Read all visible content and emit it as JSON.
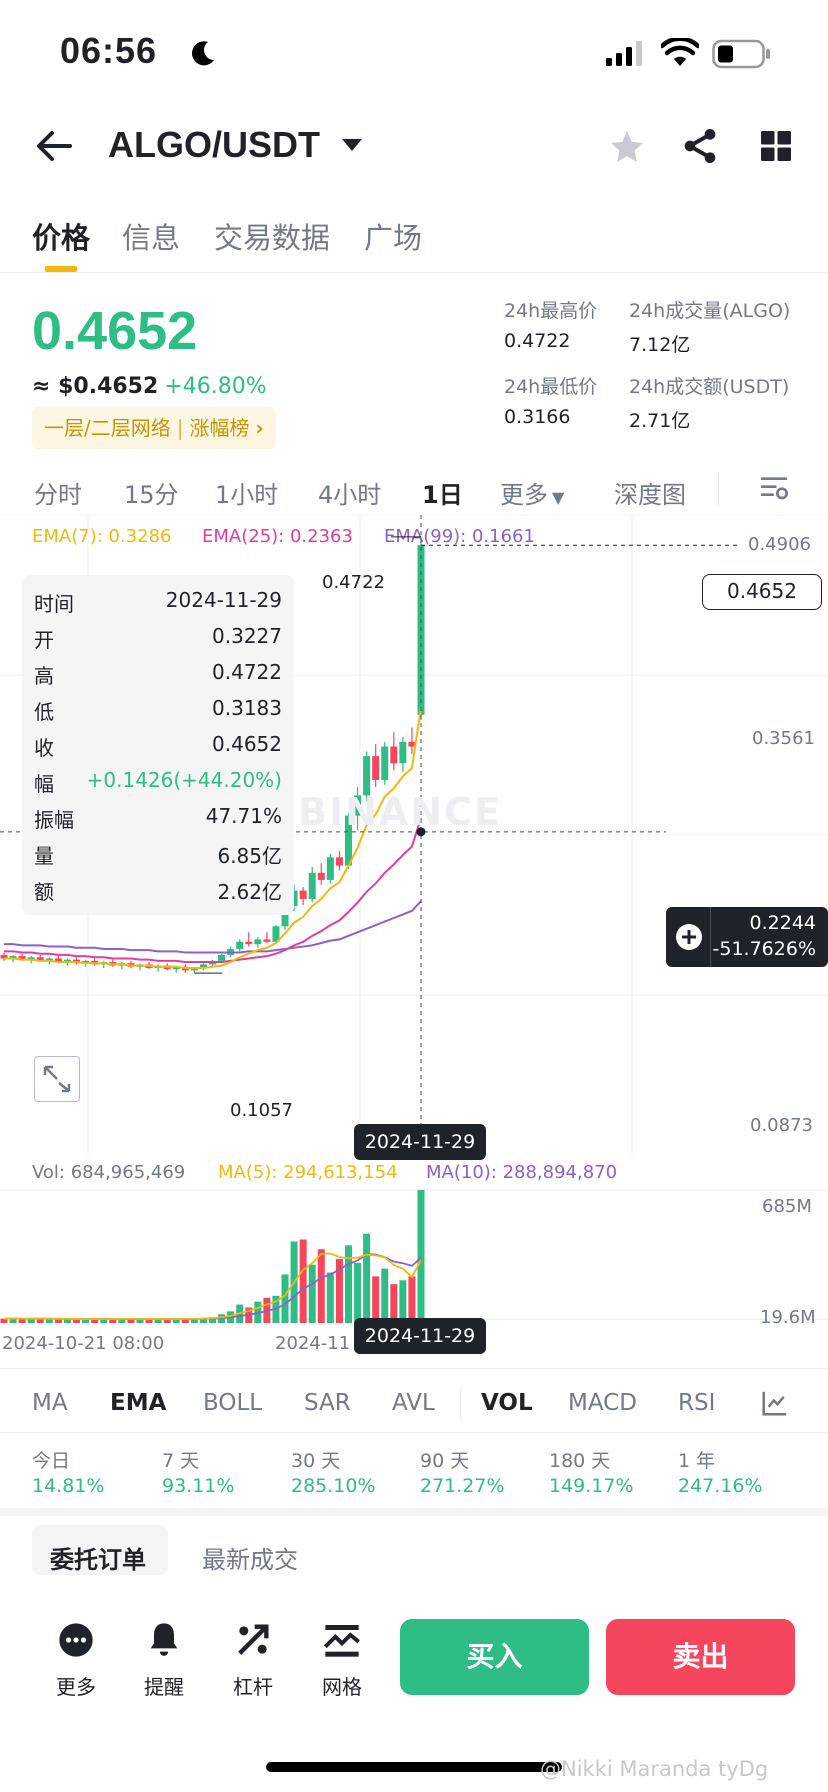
{
  "status": {
    "time": "06:56"
  },
  "header": {
    "pair": "ALGO/USDT"
  },
  "tabs": [
    "价格",
    "信息",
    "交易数据",
    "广场"
  ],
  "ticker": {
    "price": "0.4652",
    "usd": "≈ $0.4652",
    "change": "+46.80%",
    "tag": "一层/二层网络",
    "tag_link": "涨幅榜",
    "high_label": "24h最高价",
    "high": "0.4722",
    "low_label": "24h最低价",
    "low": "0.3166",
    "vol_label": "24h成交量(ALGO)",
    "vol": "7.12亿",
    "amt_label": "24h成交额(USDT)",
    "amt": "2.71亿"
  },
  "timeframes": [
    "分时",
    "15分",
    "1小时",
    "4小时",
    "1日",
    "更多",
    "深度图"
  ],
  "ema": {
    "e7": "EMA(7): 0.3286",
    "e25": "EMA(25): 0.2363",
    "e99": "EMA(99): 0.1661"
  },
  "price_axis": [
    "0.4906",
    "0.3561",
    "0.0873"
  ],
  "info": {
    "rows": [
      {
        "k": "时间",
        "v": "2024-11-29"
      },
      {
        "k": "开",
        "v": "0.3227"
      },
      {
        "k": "高",
        "v": "0.4722"
      },
      {
        "k": "低",
        "v": "0.3183"
      },
      {
        "k": "收",
        "v": "0.4652"
      },
      {
        "k": "幅",
        "v": "+0.1426(+44.20%)"
      },
      {
        "k": "振幅",
        "v": "47.71%"
      },
      {
        "k": "量",
        "v": "6.85亿"
      },
      {
        "k": "额",
        "v": "2.62亿"
      }
    ]
  },
  "chart_labels": {
    "high_mark": "0.4722",
    "low_mark": "0.1057",
    "last_price": "0.4652",
    "cross_price": "0.2244",
    "cross_pct": "-51.7626%",
    "cross_date": "2024-11-29",
    "watermark": "BINANCE"
  },
  "volume": {
    "vol": "Vol: 684,965,469",
    "ma5": "MA(5): 294,613,154",
    "ma10": "MA(10): 288,894,870",
    "axis_top": "685M",
    "axis_bottom": "19.6M",
    "x_start": "2024-10-21 08:00",
    "x_mid": "2024-11",
    "date_tip": "2024-11-29"
  },
  "indicators": [
    "MA",
    "EMA",
    "BOLL",
    "SAR",
    "AVL",
    "VOL",
    "MACD",
    "RSI"
  ],
  "performance": [
    {
      "label": "今日",
      "value": "14.81%"
    },
    {
      "label": "7 天",
      "value": "93.11%"
    },
    {
      "label": "30 天",
      "value": "285.10%"
    },
    {
      "label": "90 天",
      "value": "271.27%"
    },
    {
      "label": "180 天",
      "value": "149.17%"
    },
    {
      "label": "1 年",
      "value": "247.16%"
    }
  ],
  "order_tabs": [
    "委托订单",
    "最新成交"
  ],
  "bottom": {
    "more": "更多",
    "alert": "提醒",
    "leverage": "杠杆",
    "grid": "网格",
    "buy": "买入",
    "sell": "卖出"
  },
  "watermark": "@Nikki Maranda tyDg",
  "colors": {
    "up": "#2ebd85",
    "down": "#f6465d",
    "ema7": "#f0b90b",
    "ema25": "#e33ca0",
    "ema99": "#8e5fc9",
    "accent": "#f0b90b"
  },
  "chart_data": {
    "type": "candlestick",
    "candles": [
      {
        "o": 0.121,
        "h": 0.123,
        "l": 0.116,
        "c": 0.118
      },
      {
        "o": 0.118,
        "h": 0.121,
        "l": 0.115,
        "c": 0.12
      },
      {
        "o": 0.12,
        "h": 0.122,
        "l": 0.116,
        "c": 0.117
      },
      {
        "o": 0.117,
        "h": 0.12,
        "l": 0.114,
        "c": 0.119
      },
      {
        "o": 0.119,
        "h": 0.121,
        "l": 0.115,
        "c": 0.116
      },
      {
        "o": 0.116,
        "h": 0.119,
        "l": 0.113,
        "c": 0.118
      },
      {
        "o": 0.118,
        "h": 0.12,
        "l": 0.114,
        "c": 0.115
      },
      {
        "o": 0.115,
        "h": 0.118,
        "l": 0.112,
        "c": 0.117
      },
      {
        "o": 0.117,
        "h": 0.119,
        "l": 0.113,
        "c": 0.114
      },
      {
        "o": 0.114,
        "h": 0.117,
        "l": 0.111,
        "c": 0.116
      },
      {
        "o": 0.116,
        "h": 0.118,
        "l": 0.112,
        "c": 0.113
      },
      {
        "o": 0.113,
        "h": 0.116,
        "l": 0.11,
        "c": 0.115
      },
      {
        "o": 0.115,
        "h": 0.117,
        "l": 0.111,
        "c": 0.112
      },
      {
        "o": 0.112,
        "h": 0.115,
        "l": 0.109,
        "c": 0.114
      },
      {
        "o": 0.114,
        "h": 0.116,
        "l": 0.11,
        "c": 0.111
      },
      {
        "o": 0.111,
        "h": 0.114,
        "l": 0.108,
        "c": 0.113
      },
      {
        "o": 0.113,
        "h": 0.115,
        "l": 0.109,
        "c": 0.11
      },
      {
        "o": 0.11,
        "h": 0.113,
        "l": 0.107,
        "c": 0.112
      },
      {
        "o": 0.112,
        "h": 0.114,
        "l": 0.108,
        "c": 0.109
      },
      {
        "o": 0.109,
        "h": 0.112,
        "l": 0.106,
        "c": 0.111
      },
      {
        "o": 0.111,
        "h": 0.113,
        "l": 0.106,
        "c": 0.108
      },
      {
        "o": 0.108,
        "h": 0.111,
        "l": 0.1057,
        "c": 0.11
      },
      {
        "o": 0.11,
        "h": 0.114,
        "l": 0.108,
        "c": 0.113
      },
      {
        "o": 0.113,
        "h": 0.117,
        "l": 0.111,
        "c": 0.116
      },
      {
        "o": 0.116,
        "h": 0.122,
        "l": 0.114,
        "c": 0.121
      },
      {
        "o": 0.121,
        "h": 0.128,
        "l": 0.119,
        "c": 0.126
      },
      {
        "o": 0.126,
        "h": 0.134,
        "l": 0.124,
        "c": 0.132
      },
      {
        "o": 0.132,
        "h": 0.14,
        "l": 0.128,
        "c": 0.13
      },
      {
        "o": 0.13,
        "h": 0.136,
        "l": 0.127,
        "c": 0.134
      },
      {
        "o": 0.134,
        "h": 0.14,
        "l": 0.131,
        "c": 0.132
      },
      {
        "o": 0.132,
        "h": 0.146,
        "l": 0.13,
        "c": 0.145
      },
      {
        "o": 0.145,
        "h": 0.165,
        "l": 0.142,
        "c": 0.162
      },
      {
        "o": 0.162,
        "h": 0.18,
        "l": 0.158,
        "c": 0.175
      },
      {
        "o": 0.175,
        "h": 0.178,
        "l": 0.163,
        "c": 0.168
      },
      {
        "o": 0.168,
        "h": 0.195,
        "l": 0.165,
        "c": 0.19
      },
      {
        "o": 0.19,
        "h": 0.198,
        "l": 0.18,
        "c": 0.184
      },
      {
        "o": 0.184,
        "h": 0.206,
        "l": 0.181,
        "c": 0.203
      },
      {
        "o": 0.203,
        "h": 0.208,
        "l": 0.192,
        "c": 0.196
      },
      {
        "o": 0.196,
        "h": 0.24,
        "l": 0.193,
        "c": 0.238
      },
      {
        "o": 0.238,
        "h": 0.262,
        "l": 0.226,
        "c": 0.255
      },
      {
        "o": 0.255,
        "h": 0.292,
        "l": 0.25,
        "c": 0.288
      },
      {
        "o": 0.288,
        "h": 0.298,
        "l": 0.262,
        "c": 0.268
      },
      {
        "o": 0.268,
        "h": 0.3,
        "l": 0.264,
        "c": 0.296
      },
      {
        "o": 0.296,
        "h": 0.308,
        "l": 0.276,
        "c": 0.282
      },
      {
        "o": 0.282,
        "h": 0.304,
        "l": 0.275,
        "c": 0.3
      },
      {
        "o": 0.3,
        "h": 0.312,
        "l": 0.29,
        "c": 0.296
      },
      {
        "o": 0.3227,
        "h": 0.4722,
        "l": 0.3183,
        "c": 0.4652
      }
    ],
    "ema7": [
      0.118,
      0.118,
      0.117,
      0.117,
      0.116,
      0.116,
      0.115,
      0.115,
      0.115,
      0.114,
      0.114,
      0.114,
      0.113,
      0.113,
      0.112,
      0.112,
      0.112,
      0.111,
      0.111,
      0.111,
      0.11,
      0.11,
      0.11,
      0.111,
      0.112,
      0.115,
      0.119,
      0.122,
      0.125,
      0.127,
      0.131,
      0.139,
      0.148,
      0.153,
      0.162,
      0.168,
      0.177,
      0.182,
      0.196,
      0.211,
      0.23,
      0.239,
      0.254,
      0.261,
      0.271,
      0.278,
      0.3286
    ],
    "ema25": [
      0.124,
      0.124,
      0.123,
      0.123,
      0.122,
      0.122,
      0.121,
      0.121,
      0.12,
      0.12,
      0.119,
      0.119,
      0.118,
      0.118,
      0.118,
      0.117,
      0.117,
      0.116,
      0.116,
      0.116,
      0.115,
      0.115,
      0.115,
      0.115,
      0.115,
      0.116,
      0.117,
      0.118,
      0.119,
      0.12,
      0.122,
      0.125,
      0.129,
      0.132,
      0.137,
      0.141,
      0.146,
      0.15,
      0.157,
      0.165,
      0.174,
      0.181,
      0.19,
      0.197,
      0.205,
      0.212,
      0.2363
    ],
    "ema99": [
      0.13,
      0.13,
      0.129,
      0.129,
      0.129,
      0.128,
      0.128,
      0.128,
      0.127,
      0.127,
      0.127,
      0.126,
      0.126,
      0.126,
      0.125,
      0.125,
      0.125,
      0.124,
      0.124,
      0.124,
      0.123,
      0.123,
      0.123,
      0.123,
      0.123,
      0.123,
      0.123,
      0.124,
      0.124,
      0.124,
      0.125,
      0.126,
      0.127,
      0.128,
      0.129,
      0.131,
      0.133,
      0.134,
      0.137,
      0.14,
      0.143,
      0.146,
      0.149,
      0.152,
      0.155,
      0.158,
      0.1661
    ],
    "ylim": [
      0.0873,
      0.4906
    ],
    "volumes": [
      22,
      24,
      20,
      21,
      25,
      19,
      22,
      20,
      18,
      23,
      21,
      19,
      24,
      20,
      22,
      18,
      21,
      23,
      19,
      20,
      24,
      22,
      26,
      30,
      45,
      60,
      95,
      80,
      110,
      130,
      140,
      250,
      420,
      430,
      300,
      380,
      260,
      330,
      400,
      310,
      460,
      240,
      280,
      200,
      220,
      240,
      685
    ],
    "vol_ylim": [
      19.6,
      685
    ]
  }
}
